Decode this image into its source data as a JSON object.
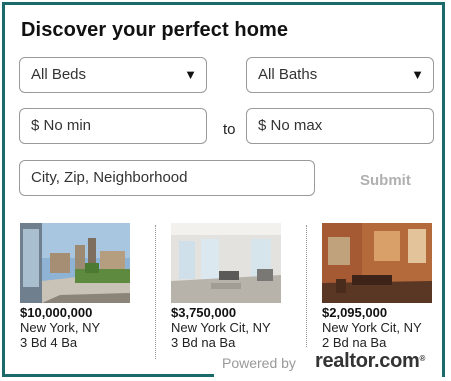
{
  "header": {
    "title": "Discover your perfect home"
  },
  "filters": {
    "beds_selected": "All Beds",
    "baths_selected": "All Baths",
    "min_placeholder": "$ No min",
    "to_label": "to",
    "max_placeholder": "$ No max",
    "location_placeholder": "City, Zip, Neighborhood",
    "submit_label": "Submit",
    "dropdown_icon": "▼"
  },
  "listings": [
    {
      "price": "$10,000,000",
      "location": "New York, NY",
      "details": "3 Bd 4 Ba"
    },
    {
      "price": "$3,750,000",
      "location": "New York Cit, NY",
      "details": "3 Bd na Ba"
    },
    {
      "price": "$2,095,000",
      "location": "New York Cit, NY",
      "details": "2 Bd na Ba"
    }
  ],
  "footer": {
    "powered_by": "Powered by",
    "brand": "realtor.com",
    "brand_mark": "®"
  },
  "colors": {
    "border": "#1a6a6a",
    "submit": "#b0b0b0"
  }
}
